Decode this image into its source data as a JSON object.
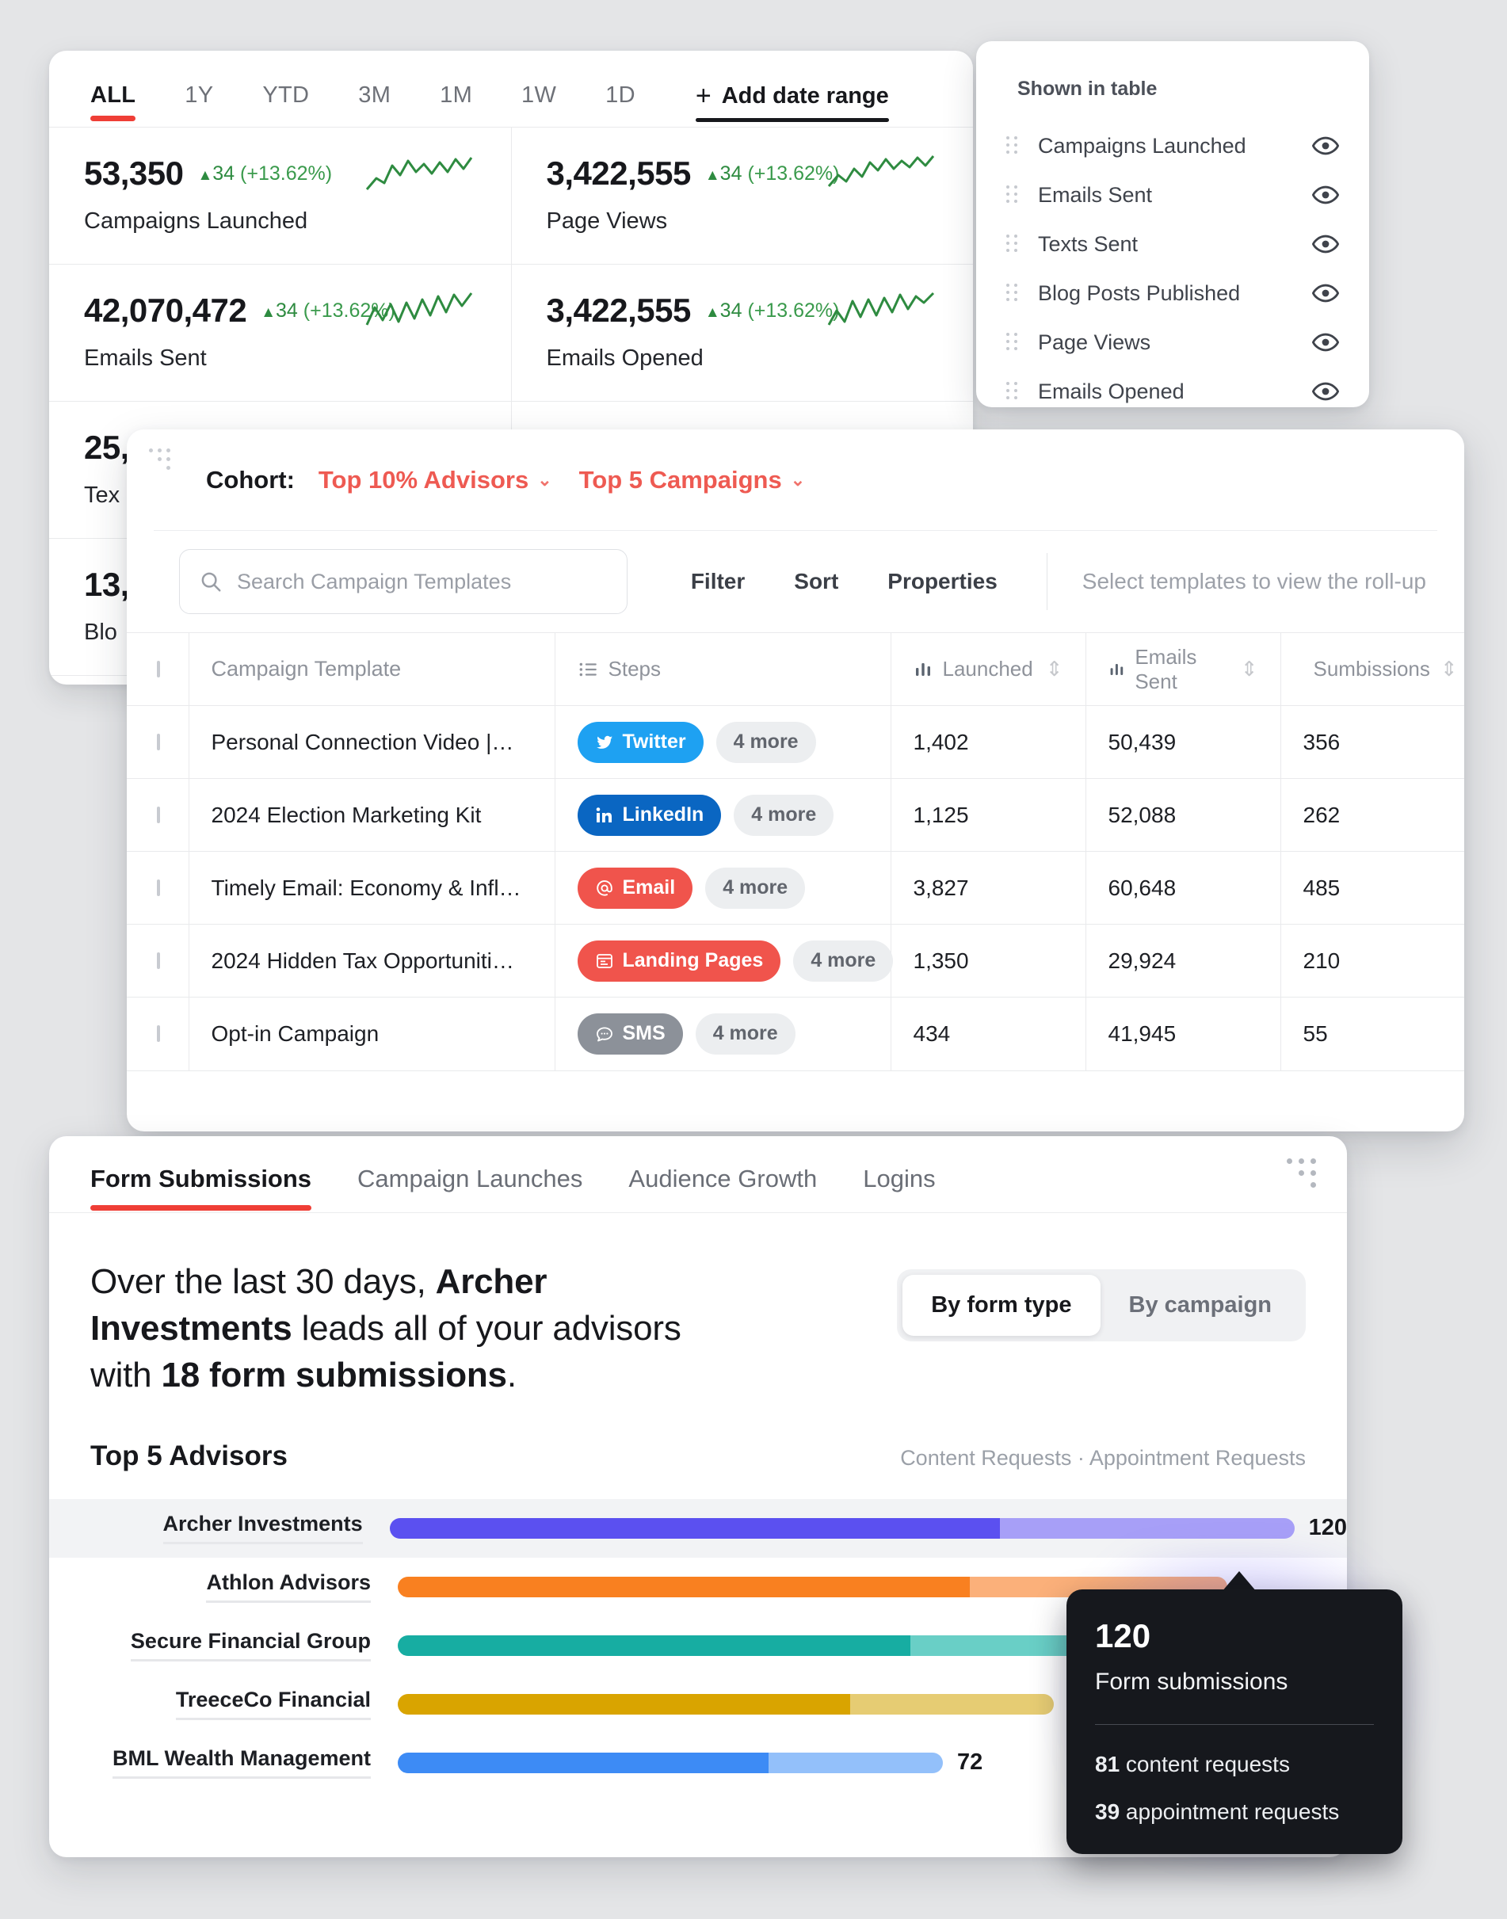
{
  "date_ranges": {
    "tabs": [
      "ALL",
      "1Y",
      "YTD",
      "3M",
      "1M",
      "1W",
      "1D"
    ],
    "active": "ALL",
    "add_label": "Add date range"
  },
  "metrics": [
    {
      "value": "53,350",
      "delta": "34",
      "delta_pct": "(+13.62%)",
      "label": "Campaigns Launched"
    },
    {
      "value": "3,422,555",
      "delta": "34",
      "delta_pct": "(+13.62%)",
      "label": "Page Views"
    },
    {
      "value": "42,070,472",
      "delta": "34",
      "delta_pct": "(+13.62%)",
      "label": "Emails Sent"
    },
    {
      "value": "3,422,555",
      "delta": "34",
      "delta_pct": "(+13.62%)",
      "label": "Emails Opened"
    },
    {
      "value": "25,",
      "delta": "",
      "delta_pct": "",
      "label": "Tex"
    },
    {
      "value": "13,",
      "delta": "",
      "delta_pct": "",
      "label": "Blo"
    }
  ],
  "shown_in_table": {
    "title": "Shown in table",
    "items": [
      {
        "label": "Campaigns Launched"
      },
      {
        "label": "Emails Sent"
      },
      {
        "label": "Texts Sent"
      },
      {
        "label": "Blog Posts Published"
      },
      {
        "label": "Page Views"
      },
      {
        "label": "Emails Opened"
      }
    ]
  },
  "cohort": {
    "label": "Cohort:",
    "filters": [
      "Top 10% Advisors",
      "Top 5 Campaigns"
    ],
    "accent": "#ee5a52"
  },
  "templates_toolbar": {
    "search_placeholder": "Search Campaign Templates",
    "filter": "Filter",
    "sort": "Sort",
    "properties": "Properties",
    "rollup_hint": "Select templates to view the roll-up"
  },
  "templates_table": {
    "headers": {
      "name": "Campaign Template",
      "steps": "Steps",
      "launched": "Launched",
      "emails_sent": "Emails Sent",
      "submissions": "Sumbissions"
    },
    "rows": [
      {
        "name": "Personal Connection Video |…",
        "chip": "Twitter",
        "chip_color": "#1ea1f2",
        "chip_icon": "twitter-icon",
        "more": "4 more",
        "launched": "1,402",
        "emails_sent": "50,439",
        "submissions": "356"
      },
      {
        "name": "2024 Election Marketing Kit",
        "chip": "LinkedIn",
        "chip_color": "#0a66c2",
        "chip_icon": "linkedin-icon",
        "more": "4 more",
        "launched": "1,125",
        "emails_sent": "52,088",
        "submissions": "262"
      },
      {
        "name": "Timely Email: Economy & Infl…",
        "chip": "Email",
        "chip_color": "#f0544c",
        "chip_icon": "at-icon",
        "more": "4 more",
        "launched": "3,827",
        "emails_sent": "60,648",
        "submissions": "485"
      },
      {
        "name": "2024 Hidden Tax Opportuniti…",
        "chip": "Landing Pages",
        "chip_color": "#f0544c",
        "chip_icon": "landing-page-icon",
        "more": "4 more",
        "launched": "1,350",
        "emails_sent": "29,924",
        "submissions": "210"
      },
      {
        "name": "Opt-in Campaign",
        "chip": "SMS",
        "chip_color": "#8c9199",
        "chip_icon": "sms-icon",
        "more": "4 more",
        "launched": "434",
        "emails_sent": "41,945",
        "submissions": "55"
      }
    ]
  },
  "insights": {
    "tabs": [
      "Form Submissions",
      "Campaign Launches",
      "Audience Growth",
      "Logins"
    ],
    "active_tab": "Form Submissions",
    "headline_pre": "Over the last 30 days, ",
    "headline_brand": "Archer Investments",
    "headline_mid": " leads all of your advisors with ",
    "headline_count": "18 form submissions",
    "headline_post": ".",
    "toggle": {
      "options": [
        "By form type",
        "By campaign"
      ],
      "active": "By form type"
    }
  },
  "chart_data": {
    "type": "bar",
    "title": "Top 5 Advisors",
    "legend": "Content Requests · Appointment Requests",
    "orientation": "horizontal",
    "stacked": true,
    "xlabel": "",
    "ylabel": "",
    "categories": [
      "Archer Investments",
      "Athlon Advisors",
      "Secure Financial Group",
      "TreeceCo Financial",
      "BML Wealth Management"
    ],
    "values": [
      120,
      110,
      99,
      87,
      72
    ],
    "series": [
      {
        "name": "Content Requests",
        "values": [
          81,
          76,
          68,
          60,
          49
        ]
      },
      {
        "name": "Appointment Requests",
        "values": [
          39,
          34,
          31,
          27,
          23
        ]
      }
    ],
    "value_labels": [
      "120",
      "",
      "99",
      "87",
      "72"
    ],
    "colors": [
      "#5b50f0",
      "#f98020",
      "#17ada2",
      "#d9a400",
      "#3d8bf5"
    ],
    "colors_light": [
      "#a79ff7",
      "#fbb07a",
      "#69cfc6",
      "#e6cc73",
      "#93c0fa"
    ],
    "xlim": [
      0,
      120
    ],
    "highlight_index": 0
  },
  "tooltip": {
    "value": "120",
    "subtitle": "Form submissions",
    "line1_num": "81",
    "line1_text": " content requests",
    "line2_num": "39",
    "line2_text": " appointment requests"
  }
}
